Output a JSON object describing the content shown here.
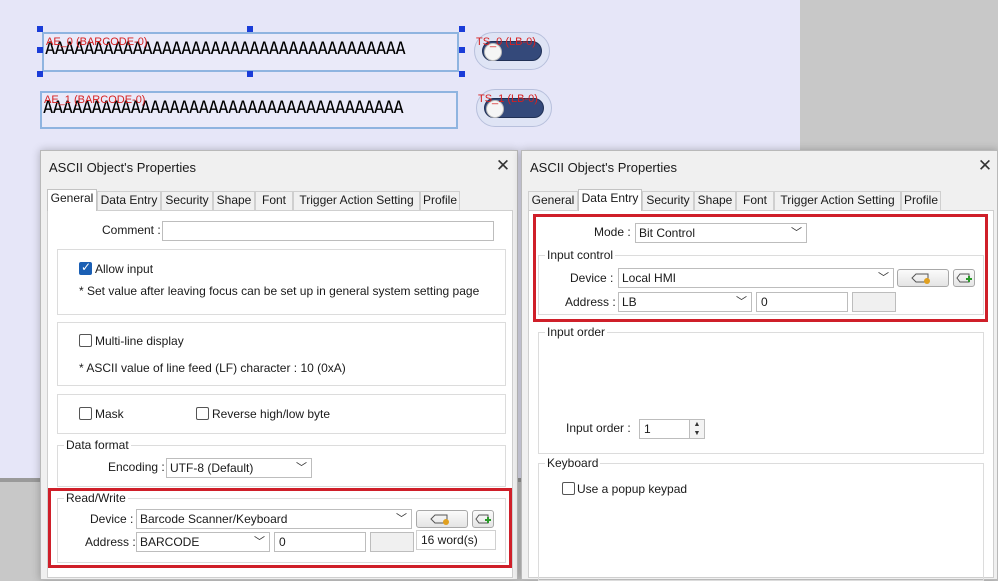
{
  "canvas": {
    "objects": [
      {
        "label": "AE_0 (BARCODE-0)",
        "text": "AAAAAAAAAAAAAAAAAAAAAAAAAAAAAAAAAAAAA"
      },
      {
        "label": "AE_1 (BARCODE-0)",
        "text": "AAAAAAAAAAAAAAAAAAAAAAAAAAAAAAAAAAAAA"
      }
    ],
    "toggles": [
      {
        "label": "TS_0 (LB-0)"
      },
      {
        "label": "TS_1 (LB-0)"
      }
    ]
  },
  "dialog_left": {
    "title": "ASCII Object's Properties",
    "close": "✕",
    "tabs": [
      "General",
      "Data Entry",
      "Security",
      "Shape",
      "Font",
      "Trigger Action Setting",
      "Profile"
    ],
    "active_tab": "General",
    "comment_label": "Comment :",
    "comment_value": "",
    "allow_input_label": "Allow input",
    "allow_input_checked": true,
    "allow_input_note": "* Set value after leaving focus can be set up in general system setting page",
    "multiline_label": "Multi-line display",
    "multiline_note": "* ASCII value of line feed (LF) character : 10 (0xA)",
    "mask_label": "Mask",
    "reverse_label": "Reverse high/low byte",
    "data_format_title": "Data format",
    "encoding_label": "Encoding :",
    "encoding_value": "UTF-8 (Default)",
    "rw_title": "Read/Write",
    "device_label": "Device :",
    "device_value": "Barcode Scanner/Keyboard",
    "address_label": "Address :",
    "address_type": "BARCODE",
    "address_value": "0",
    "words_value": "16 word(s)"
  },
  "dialog_right": {
    "title": "ASCII Object's Properties",
    "close": "✕",
    "tabs": [
      "General",
      "Data Entry",
      "Security",
      "Shape",
      "Font",
      "Trigger Action Setting",
      "Profile"
    ],
    "active_tab": "Data Entry",
    "mode_label": "Mode :",
    "mode_value": "Bit Control",
    "input_control_title": "Input control",
    "device_label": "Device :",
    "device_value": "Local HMI",
    "address_label": "Address :",
    "address_type": "LB",
    "address_value": "0",
    "input_order_title": "Input order",
    "input_order_label": "Input order :",
    "input_order_value": "1",
    "keyboard_title": "Keyboard",
    "popup_keypad_label": "Use a popup keypad"
  },
  "colors": {
    "highlight": "#cf1f29",
    "label_red": "#d62020",
    "checkbox_blue": "#1a5fb4",
    "toggle_track": "#34497a"
  }
}
